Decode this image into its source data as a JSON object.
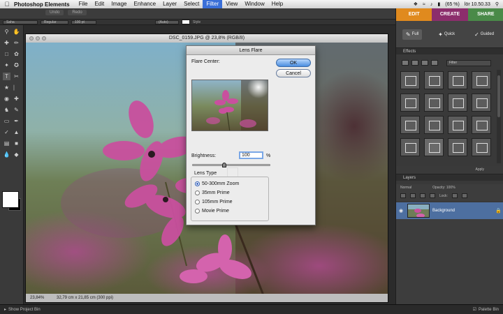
{
  "menubar": {
    "apple_icon": "apple-icon",
    "app_name": "Photoshop Elements",
    "items": [
      "File",
      "Edit",
      "Image",
      "Enhance",
      "Layer",
      "Select",
      "Filter",
      "View",
      "Window",
      "Help"
    ],
    "active_item": "Filter",
    "status": {
      "battery": "(65 %)",
      "clock": "lör 10.50.33"
    }
  },
  "optionsbar": {
    "undo_label": "Undo",
    "redo_label": "Redo",
    "font_family": "Saha",
    "font_style": "Regular",
    "font_size": "100 pt",
    "leading": "(Auto)",
    "color_label": "Style"
  },
  "document": {
    "title": "DSC_0159.JPG @ 23,8% (RGB/8)",
    "zoom": "23,84%",
    "dimensions": "32,79 cm x 21,85 cm (300 ppi)"
  },
  "dialog": {
    "title": "Lens Flare",
    "flare_center_label": "Flare Center:",
    "ok_label": "OK",
    "cancel_label": "Cancel",
    "brightness_label": "Brightness:",
    "brightness_value": "100",
    "brightness_unit": "%",
    "brightness_level": 0.4,
    "lens_type_label": "Lens Type",
    "lens_types": [
      "50-300mm Zoom",
      "35mm Prime",
      "105mm Prime",
      "Movie Prime"
    ],
    "selected_lens": "50-300mm Zoom"
  },
  "panel": {
    "tabs": {
      "edit": "EDIT",
      "create": "CREATE",
      "share": "SHARE"
    },
    "edit_modes": {
      "full": "Full",
      "quick": "Quick",
      "guided": "Guided"
    },
    "effects_title": "Effects",
    "effects_filter": "Filter",
    "apply_label": "Apply",
    "layers_title": "Layers",
    "blend_mode": "Normal",
    "opacity_label": "Opacity:",
    "opacity_value": "100%",
    "lock_label": "Lock:",
    "layer_name": "Background"
  },
  "bottombar": {
    "project_bin": "Show Project Bin",
    "palette_bin": "Palette Bin"
  },
  "colors": {
    "accent_blue": "#3a6fd8",
    "edit_tab": "#e08a1e",
    "create_tab": "#8c2e6c",
    "share_tab": "#4a8a48",
    "layer_selected": "#4d6fa0"
  }
}
